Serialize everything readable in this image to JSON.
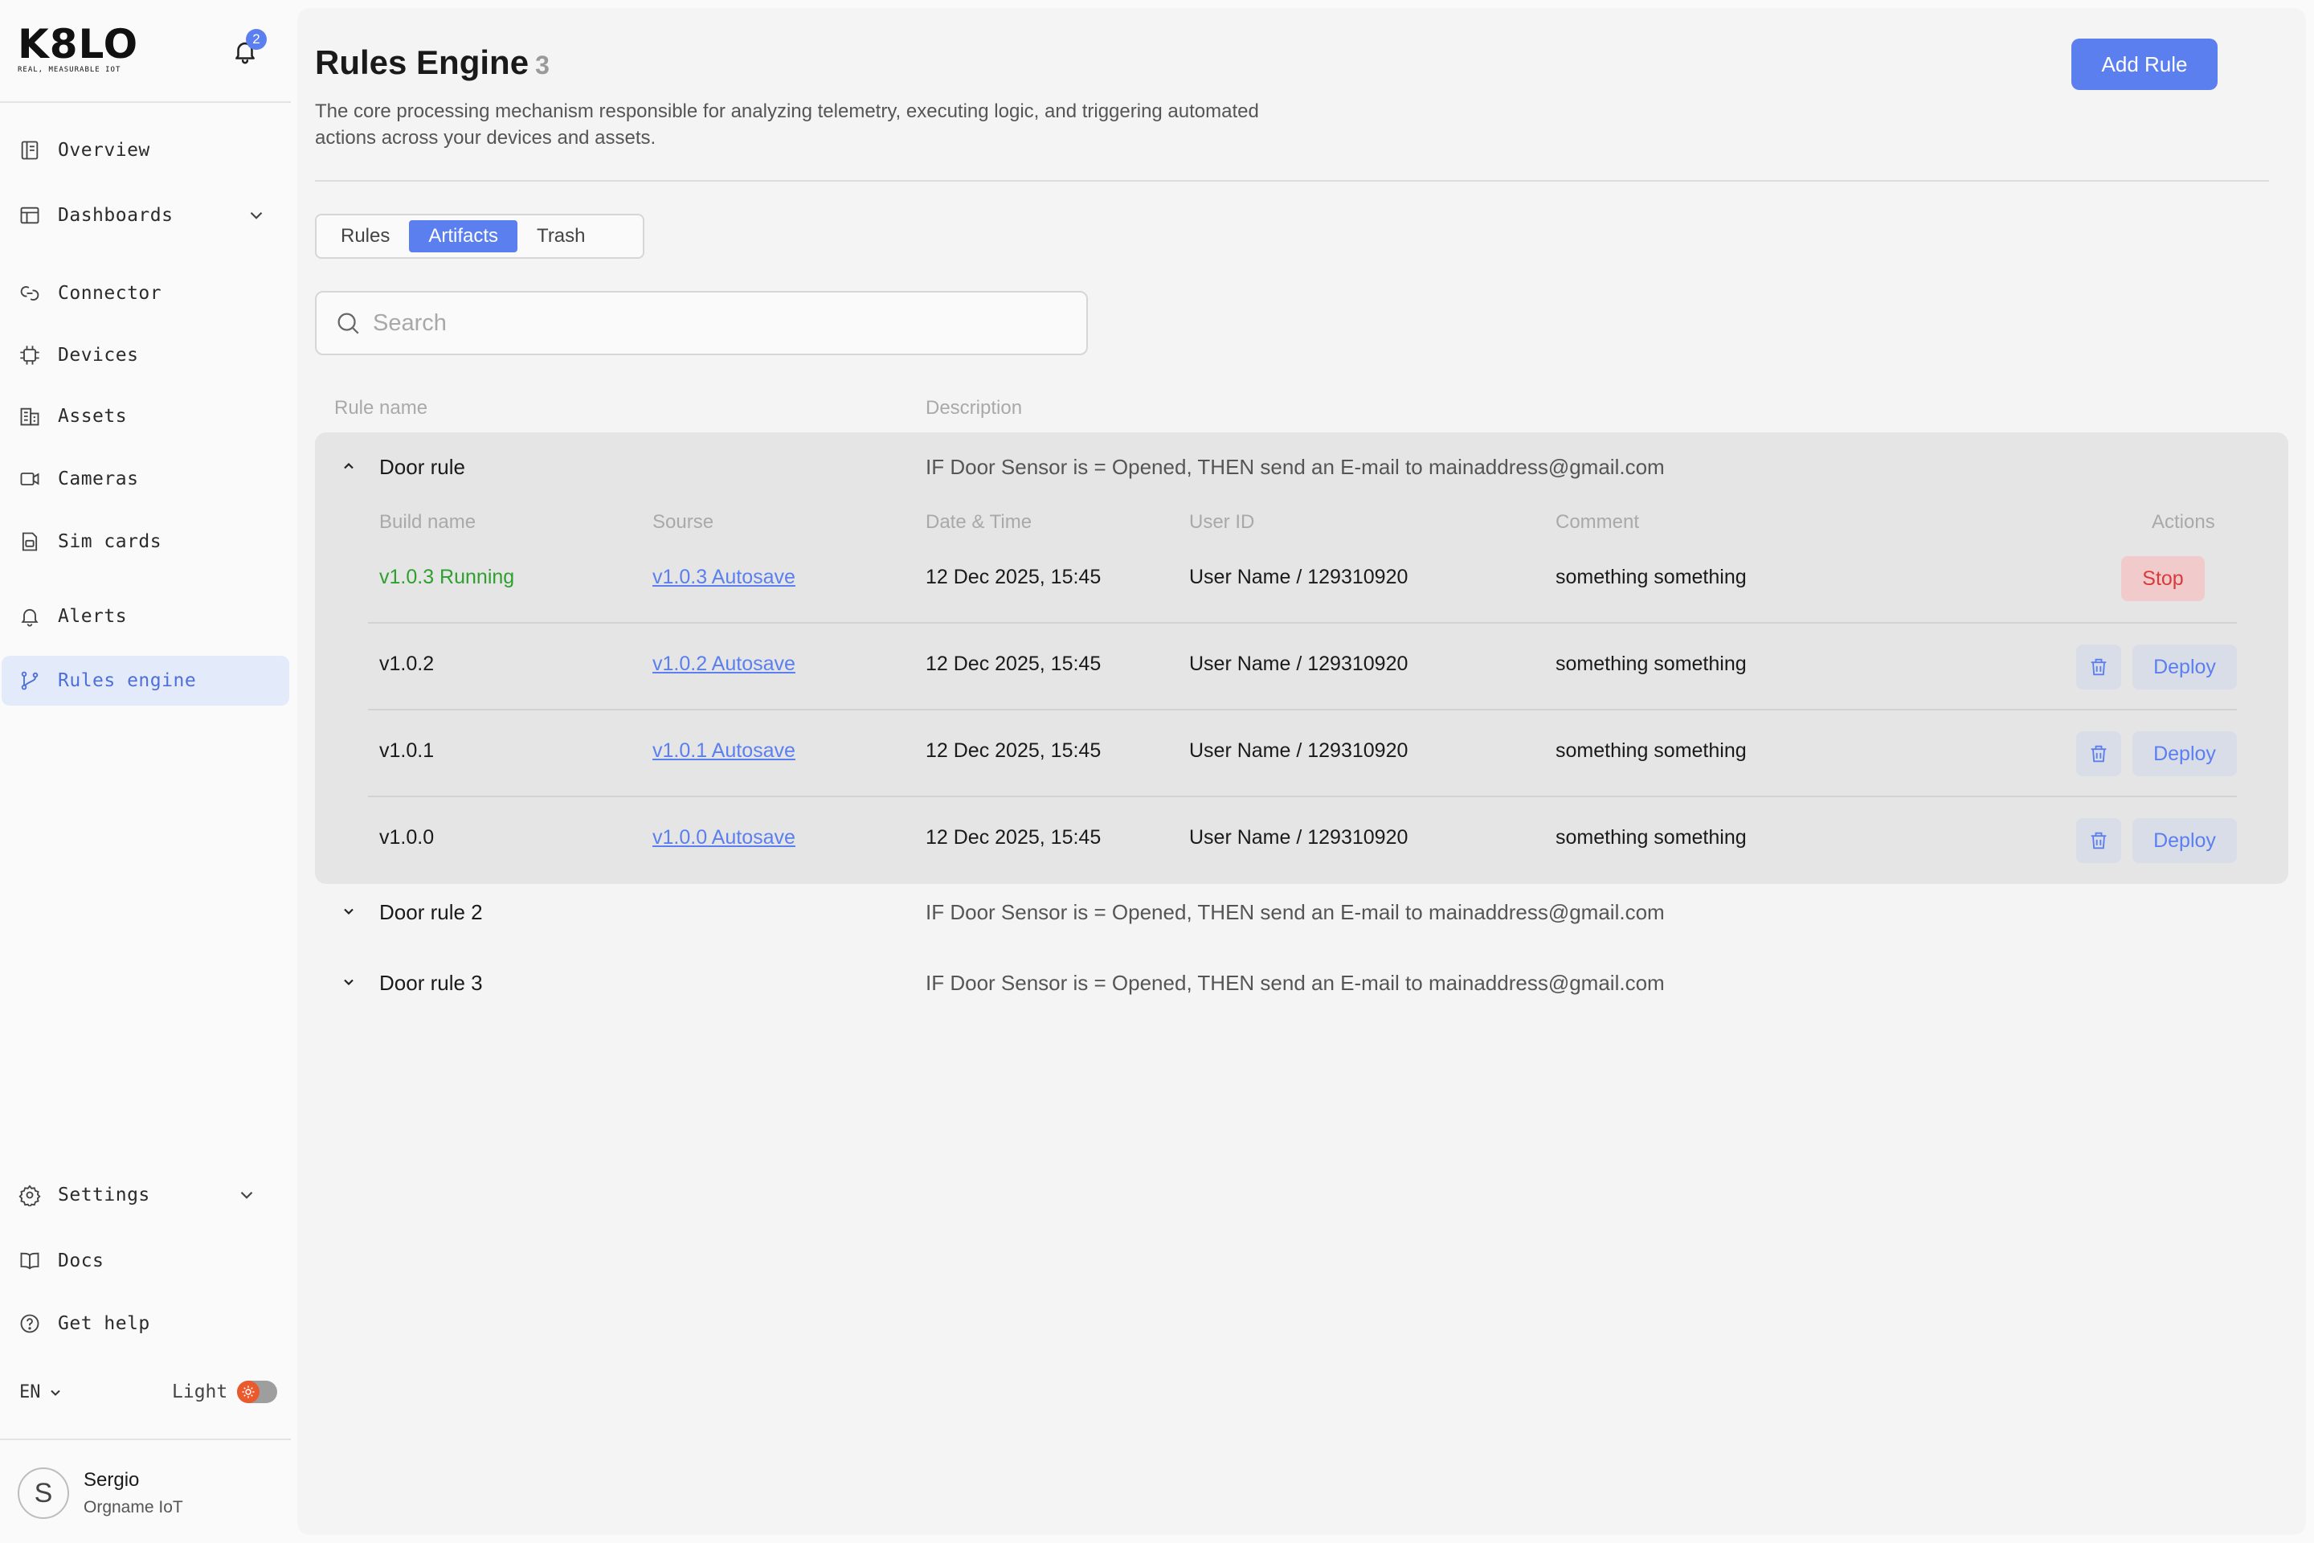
{
  "app": {
    "logo_text": "K8LO",
    "logo_tagline": "REAL, MEASURABLE IOT",
    "notifications_count": "2"
  },
  "sidebar": {
    "items": [
      {
        "label": "Overview",
        "icon": "overview-icon"
      },
      {
        "label": "Dashboards",
        "icon": "dashboard-icon"
      },
      {
        "label": "Connector",
        "icon": "connector-icon"
      },
      {
        "label": "Devices",
        "icon": "chip-icon"
      },
      {
        "label": "Assets",
        "icon": "building-icon"
      },
      {
        "label": "Cameras",
        "icon": "camera-icon"
      },
      {
        "label": "Sim cards",
        "icon": "sim-card-icon"
      },
      {
        "label": "Alerts",
        "icon": "bell-icon"
      },
      {
        "label": "Rules engine",
        "icon": "git-branch-icon",
        "active": true
      }
    ],
    "bottom_items": [
      {
        "label": "Settings",
        "icon": "gear-icon"
      },
      {
        "label": "Docs",
        "icon": "book-icon"
      },
      {
        "label": "Get help",
        "icon": "help-icon"
      }
    ],
    "language": "EN",
    "theme_label": "Light",
    "user": {
      "initial": "S",
      "name": "Sergio",
      "org": "Orgname IoT"
    }
  },
  "header": {
    "title": "Rules Engine",
    "count": "3",
    "description": "The core processing mechanism responsible for analyzing telemetry, executing logic, and triggering automated actions across your devices and assets.",
    "add_button": "Add Rule"
  },
  "tabs": [
    {
      "label": "Rules",
      "active": false
    },
    {
      "label": "Artifacts",
      "active": true
    },
    {
      "label": "Trash",
      "active": false
    }
  ],
  "search": {
    "placeholder": "Search",
    "value": ""
  },
  "table": {
    "columns": {
      "rule_name": "Rule name",
      "description": "Description"
    },
    "build_columns": {
      "build_name": "Build name",
      "source": "Sourse",
      "datetime": "Date & Time",
      "user_id": "User ID",
      "comment": "Comment",
      "actions": "Actions"
    },
    "rules": [
      {
        "name": "Door rule",
        "description": "IF Door Sensor is = Opened, THEN send an E-mail to mainaddress@gmail.com",
        "expanded": true,
        "builds": [
          {
            "name": "v1.0.3 Running",
            "source": "v1.0.3 Autosave",
            "datetime": "12 Dec 2025, 15:45",
            "user": "User Name / 129310920",
            "comment": "something something",
            "action": "Stop"
          },
          {
            "name": "v1.0.2",
            "source": "v1.0.2 Autosave",
            "datetime": "12 Dec 2025, 15:45",
            "user": "User Name / 129310920",
            "comment": "something something",
            "action": "Deploy"
          },
          {
            "name": "v1.0.1",
            "source": "v1.0.1 Autosave",
            "datetime": "12 Dec 2025, 15:45",
            "user": "User Name / 129310920",
            "comment": "something something",
            "action": "Deploy"
          },
          {
            "name": "v1.0.0",
            "source": "v1.0.0 Autosave",
            "datetime": "12 Dec 2025, 15:45",
            "user": "User Name / 129310920",
            "comment": "something something",
            "action": "Deploy"
          }
        ]
      },
      {
        "name": "Door rule 2",
        "description": "IF Door Sensor is = Opened, THEN send an E-mail to mainaddress@gmail.com",
        "expanded": false
      },
      {
        "name": "Door rule 3",
        "description": "IF Door Sensor is = Opened, THEN send an E-mail to mainaddress@gmail.com",
        "expanded": false
      }
    ]
  },
  "colors": {
    "accent": "#5b7fef",
    "running": "#2ea02e",
    "stop": "#d93a3a",
    "active_nav_bg": "#e3ebfa",
    "theme_toggle": "#ea5a2d"
  }
}
